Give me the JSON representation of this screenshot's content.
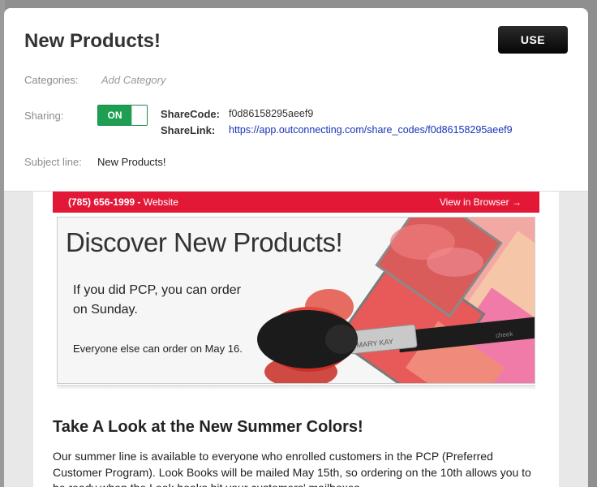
{
  "header": {
    "title": "New Products!",
    "use_label": "USE"
  },
  "fields": {
    "categories_label": "Categories:",
    "categories_placeholder": "Add Category",
    "sharing_label": "Sharing:",
    "sharing_state": "ON",
    "sharecode_label": "ShareCode:",
    "sharecode_value": "f0d86158295aeef9",
    "sharelink_label": "ShareLink:",
    "sharelink_value": "https://app.outconnecting.com/share_codes/f0d86158295aeef9",
    "subject_label": "Subject line:",
    "subject_value": "New Products!"
  },
  "email": {
    "phone": "(785) 656-1999",
    "separator": " - ",
    "website": "Website",
    "view_in_browser": "View in Browser →",
    "banner": {
      "headline": "Discover New Products!",
      "text1": "If you did PCP, you can order  on Sunday.",
      "text2": "Everyone else can order on May 16.",
      "brush_brand": "MARY KAY",
      "palette_label": "cheek"
    },
    "section_heading": "Take A Look at the New Summer Colors!",
    "paragraph": "Our summer line is available to everyone who enrolled customers in the PCP (Preferred Customer Program). Look Books will be mailed May 15th, so ordering on the 10th allows you to be ready when the Look books hit your customers' mailboxes."
  },
  "colors": {
    "accent_red": "#e31837",
    "toggle_green": "#1e9e53",
    "link_blue": "#1a33b8"
  }
}
